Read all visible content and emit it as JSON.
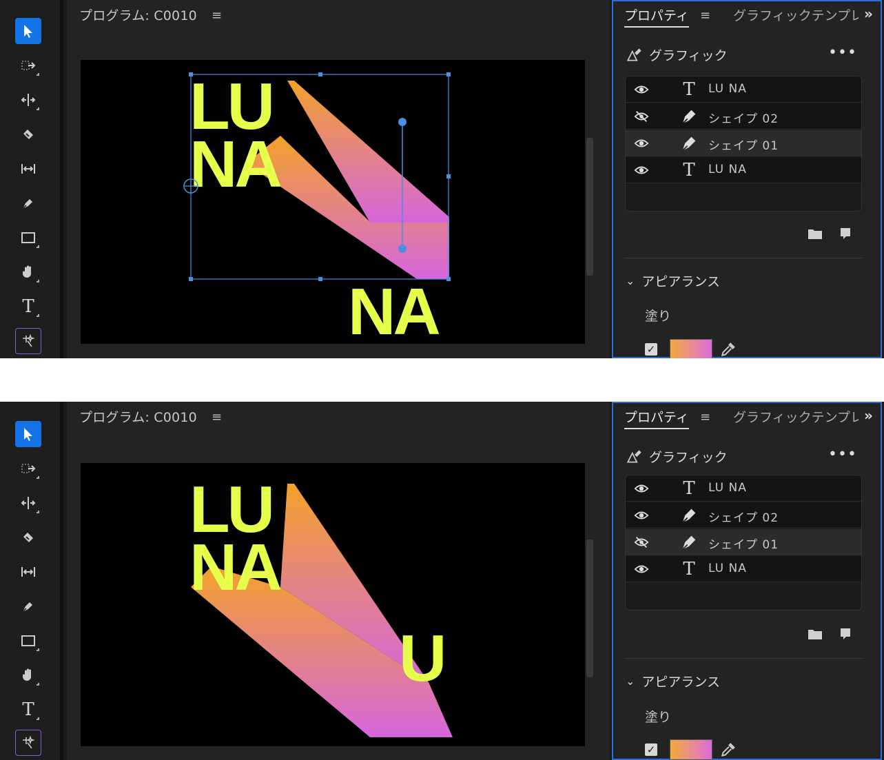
{
  "shots": [
    {
      "monitor": {
        "title": "プログラム: C0010",
        "menu_icon": "hamburger-icon",
        "canvas_text": [
          "LU",
          "NA",
          "NA"
        ]
      },
      "panel": {
        "tab_active": "プロパティ",
        "tab_other": "グラフィックテンプレート",
        "section": "グラフィック",
        "layers": [
          {
            "type": "text",
            "name": "LU NA",
            "visible": true,
            "selected": false
          },
          {
            "type": "shape",
            "name": "シェイプ 02",
            "visible": false,
            "selected": false
          },
          {
            "type": "shape",
            "name": "シェイプ 01",
            "visible": true,
            "selected": true
          },
          {
            "type": "text",
            "name": "LU NA",
            "visible": true,
            "selected": false
          }
        ],
        "appearance": "アピアランス",
        "fill_label": "塗り"
      }
    },
    {
      "monitor": {
        "title": "プログラム: C0010",
        "menu_icon": "hamburger-icon",
        "canvas_text": [
          "LU",
          "NA",
          "U"
        ]
      },
      "panel": {
        "tab_active": "プロパティ",
        "tab_other": "グラフィックテンプレート",
        "section": "グラフィック",
        "layers": [
          {
            "type": "text",
            "name": "LU NA",
            "visible": true,
            "selected": false
          },
          {
            "type": "shape",
            "name": "シェイプ 02",
            "visible": true,
            "selected": false
          },
          {
            "type": "shape",
            "name": "シェイプ 01",
            "visible": false,
            "selected": true
          },
          {
            "type": "text",
            "name": "LU NA",
            "visible": true,
            "selected": false
          }
        ],
        "appearance": "アピアランス",
        "fill_label": "塗り"
      }
    }
  ],
  "colors": {
    "accent": "#1473e6",
    "panel_border": "#2e6fd9",
    "text_yellow": "#e5ff4a",
    "gradient_start": "#f2a22a",
    "gradient_end": "#d666dd"
  }
}
